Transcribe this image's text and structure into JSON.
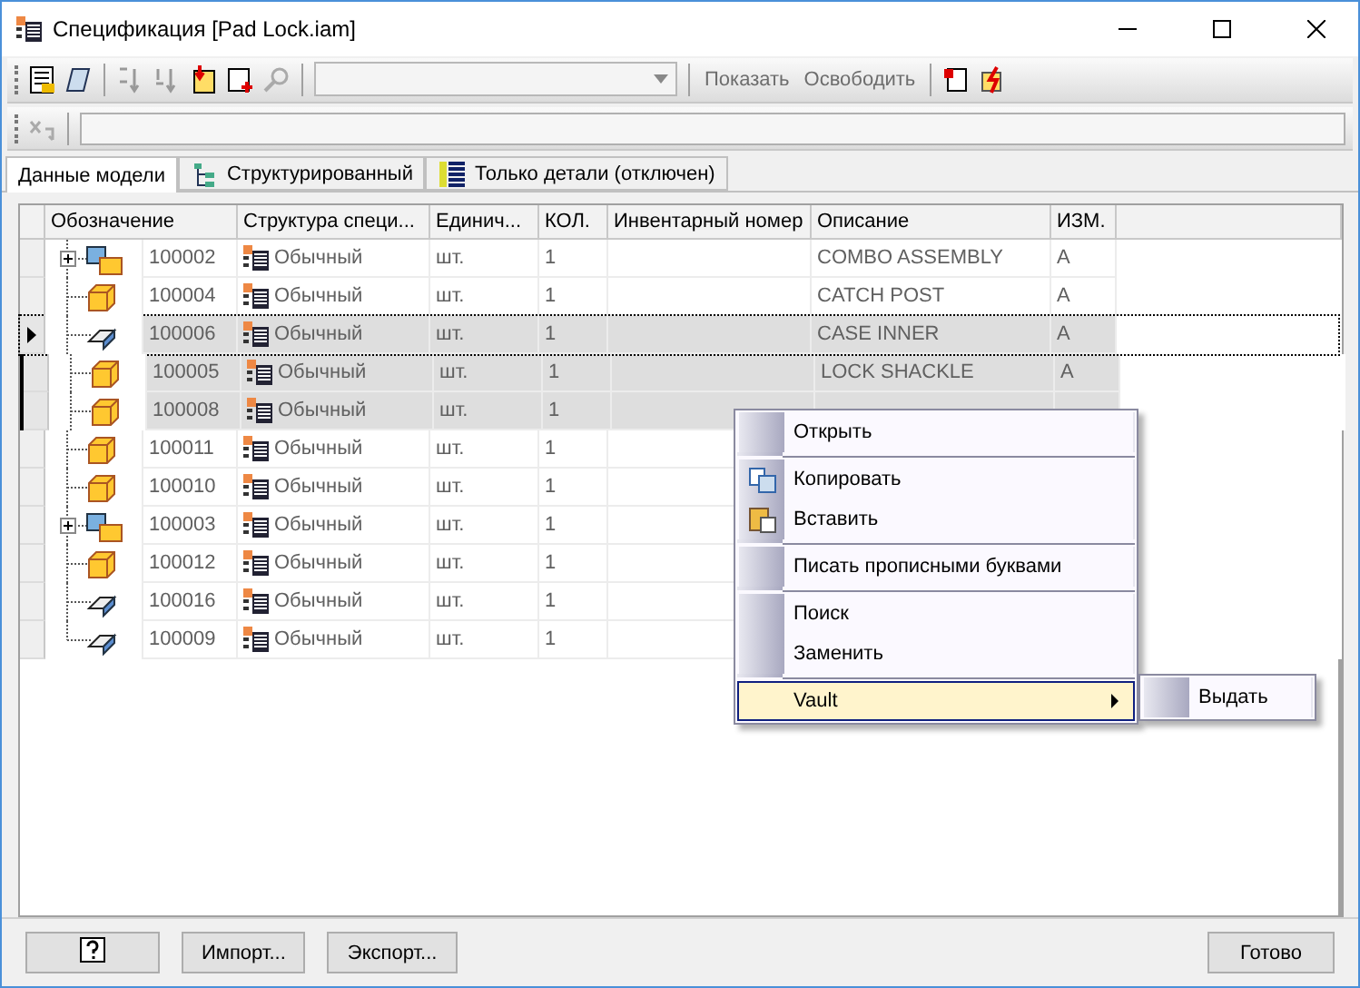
{
  "window": {
    "title": "Спецификация [Pad Lock.iam]"
  },
  "toolbar": {
    "buttons": [
      "Показать",
      "Освободить"
    ]
  },
  "tabs": [
    {
      "label": "Данные модели",
      "selected": true,
      "kind": "plain"
    },
    {
      "label": "Структурированный",
      "selected": false,
      "kind": "tree"
    },
    {
      "label": "Только детали (отключен)",
      "selected": false,
      "kind": "list"
    }
  ],
  "table": {
    "columns": [
      "Обозначение",
      "Структура специ...",
      "Единич...",
      "КОЛ.",
      "Инвентарный номер",
      "Описание",
      "ИЗМ."
    ],
    "rows": [
      {
        "kind": "assembly",
        "expandable": true,
        "selected": false,
        "current": false,
        "cells": [
          "100002",
          "Обычный",
          "шт.",
          "1",
          "",
          "COMBO ASSEMBLY",
          "A"
        ]
      },
      {
        "kind": "part",
        "expandable": false,
        "selected": false,
        "current": false,
        "cells": [
          "100004",
          "Обычный",
          "шт.",
          "1",
          "",
          "CATCH POST",
          "A"
        ]
      },
      {
        "kind": "sheet",
        "expandable": false,
        "selected": true,
        "current": true,
        "cells": [
          "100006",
          "Обычный",
          "шт.",
          "1",
          "",
          "CASE INNER",
          "A"
        ]
      },
      {
        "kind": "part",
        "expandable": false,
        "selected": true,
        "current": false,
        "cells": [
          "100005",
          "Обычный",
          "шт.",
          "1",
          "",
          "LOCK SHACKLE",
          "A"
        ]
      },
      {
        "kind": "part",
        "expandable": false,
        "selected": true,
        "current": false,
        "cells": [
          "100008",
          "Обычный",
          "шт.",
          "1",
          "",
          "",
          ""
        ]
      },
      {
        "kind": "part",
        "expandable": false,
        "selected": false,
        "current": false,
        "cells": [
          "100011",
          "Обычный",
          "шт.",
          "1",
          "",
          "",
          ""
        ]
      },
      {
        "kind": "part",
        "expandable": false,
        "selected": false,
        "current": false,
        "cells": [
          "100010",
          "Обычный",
          "шт.",
          "1",
          "",
          "",
          ""
        ]
      },
      {
        "kind": "assembly",
        "expandable": true,
        "selected": false,
        "current": false,
        "cells": [
          "100003",
          "Обычный",
          "шт.",
          "1",
          "",
          "",
          ""
        ]
      },
      {
        "kind": "part",
        "expandable": false,
        "selected": false,
        "current": false,
        "cells": [
          "100012",
          "Обычный",
          "шт.",
          "1",
          "",
          "",
          ""
        ]
      },
      {
        "kind": "sheet",
        "expandable": false,
        "selected": false,
        "current": false,
        "cells": [
          "100016",
          "Обычный",
          "шт.",
          "1",
          "",
          "",
          ""
        ]
      },
      {
        "kind": "sheet",
        "expandable": false,
        "selected": false,
        "current": false,
        "cells": [
          "100009",
          "Обычный",
          "шт.",
          "1",
          "",
          "",
          ""
        ]
      }
    ]
  },
  "context_menu": {
    "groups": [
      [
        {
          "label": "Открыть",
          "kind": "plain",
          "highlighted": false,
          "submenu": false
        }
      ],
      [
        {
          "label": "Копировать",
          "kind": "copy",
          "highlighted": false,
          "submenu": false
        },
        {
          "label": "Вставить",
          "kind": "paste",
          "highlighted": false,
          "submenu": false
        }
      ],
      [
        {
          "label": "Писать прописными буквами",
          "kind": "plain",
          "highlighted": false,
          "submenu": false
        }
      ],
      [
        {
          "label": "Поиск",
          "kind": "plain",
          "highlighted": false,
          "submenu": false
        },
        {
          "label": "Заменить",
          "kind": "plain",
          "highlighted": false,
          "submenu": false
        }
      ],
      [
        {
          "label": "Vault",
          "kind": "plain",
          "highlighted": true,
          "submenu": true
        }
      ]
    ],
    "submenu": [
      "Выдать"
    ]
  },
  "footer": {
    "buttons": [
      "Импорт...",
      "Экспорт...",
      "Готово"
    ]
  }
}
